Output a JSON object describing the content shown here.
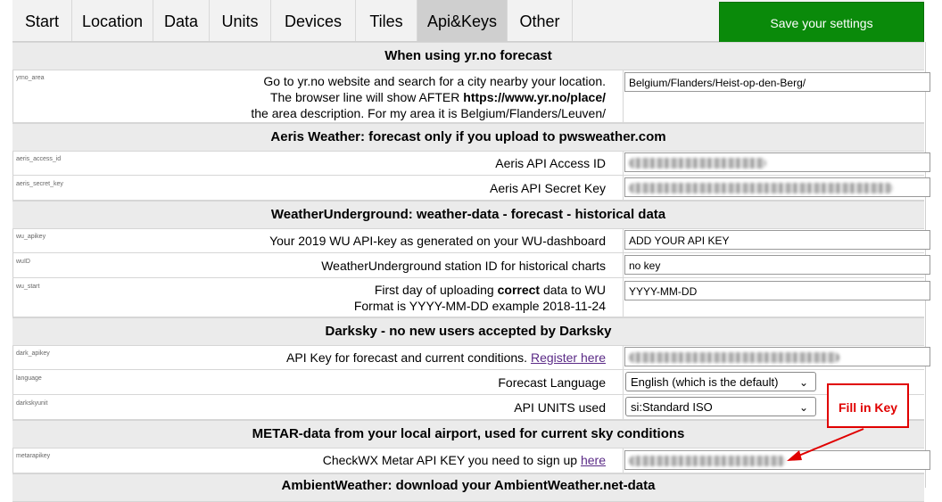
{
  "tabs": [
    "Start",
    "Location",
    "Data",
    "Units",
    "Devices",
    "Tiles",
    "Api&Keys",
    "Other"
  ],
  "active_tab": "Api&Keys",
  "save_button": "Save your settings",
  "sections": {
    "yrno": "When using yr.no forecast",
    "aeris": "Aeris Weather: forecast only if you upload to pwsweather.com",
    "wu": "WeatherUnderground: weather-data - forecast - historical data",
    "darksky": "Darksky - no new users accepted by Darksky",
    "metar": "METAR-data from your local airport, used for current sky conditions",
    "ambient": "AmbientWeather: download your AmbientWeather.net-data"
  },
  "rows": {
    "yrno_area": {
      "key": "yrno_area",
      "line1": "Go to yr.no website and search for a city nearby your location.",
      "line2_pre": "The browser line will show AFTER ",
      "line2_bold": "https://www.yr.no/place/",
      "line3": "the area description. For my area it is Belgium/Flanders/Leuven/",
      "value": "Belgium/Flanders/Heist-op-den-Berg/"
    },
    "aeris_access_id": {
      "key": "aeris_access_id",
      "label": "Aeris API Access ID"
    },
    "aeris_secret_key": {
      "key": "aeris_secret_key",
      "label": "Aeris API Secret Key"
    },
    "wu_apikey": {
      "key": "wu_apikey",
      "label": "Your 2019 WU API-key as generated on your WU-dashboard",
      "value": "ADD YOUR API KEY"
    },
    "wuID": {
      "key": "wuID",
      "label": "WeatherUnderground station ID for historical charts",
      "value": "no key"
    },
    "wu_start": {
      "key": "wu_start",
      "line1_pre": "First day of uploading ",
      "line1_bold": "correct",
      "line1_post": " data to WU",
      "line2": "Format is YYYY-MM-DD example 2018-11-24",
      "value": "YYYY-MM-DD"
    },
    "dark_apikey": {
      "key": "dark_apikey",
      "label": "API Key for forecast and current conditions.",
      "link": "Register here"
    },
    "language": {
      "key": "language",
      "label": "Forecast Language",
      "selected": "English (which is the default)"
    },
    "darkskyunit": {
      "key": "darkskyunit",
      "label": "API UNITS used",
      "selected": "si:Standard ISO"
    },
    "metarapikey": {
      "key": "metarapikey",
      "label": "CheckWX Metar API KEY you need to sign up",
      "link": "here"
    }
  },
  "annotation": {
    "text": "Fill in Key",
    "color": "#e00000"
  },
  "colors": {
    "save_green": "#0a8a0a",
    "active_tab": "#cfcfcf",
    "section_bg": "#ebebeb"
  }
}
